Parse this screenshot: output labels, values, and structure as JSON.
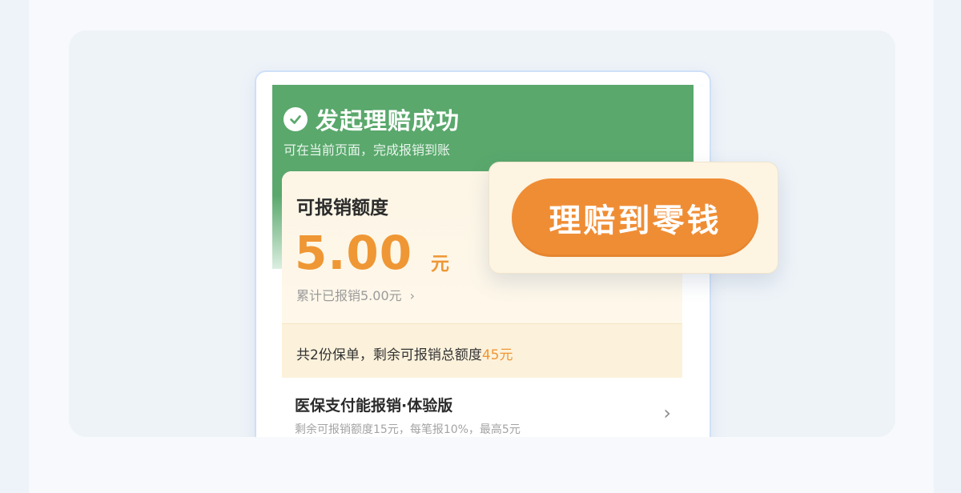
{
  "header": {
    "title": "发起理赔成功",
    "subtitle": "可在当前页面，完成报销到账"
  },
  "quota": {
    "label": "可报销额度",
    "amount": "5.00",
    "unit": "元",
    "cumulative": "累计已报销5.00元",
    "chevron": "›"
  },
  "policy_summary": {
    "prefix": "共2份保单，剩余可报销总额度",
    "amount": "45元"
  },
  "plan": {
    "title": "医保支付能报销·体验版",
    "description": "剩余可报销额度15元，每笔报10%，最高5元",
    "chevron": "›"
  },
  "popup": {
    "button_label": "理赔到零钱"
  },
  "colors": {
    "header_green": "#5aa86c",
    "accent_orange": "#ef8d35",
    "card_cream": "#fdf6e6"
  },
  "icons": {
    "success": "check-circle-icon",
    "chevron": "chevron-right-icon"
  }
}
